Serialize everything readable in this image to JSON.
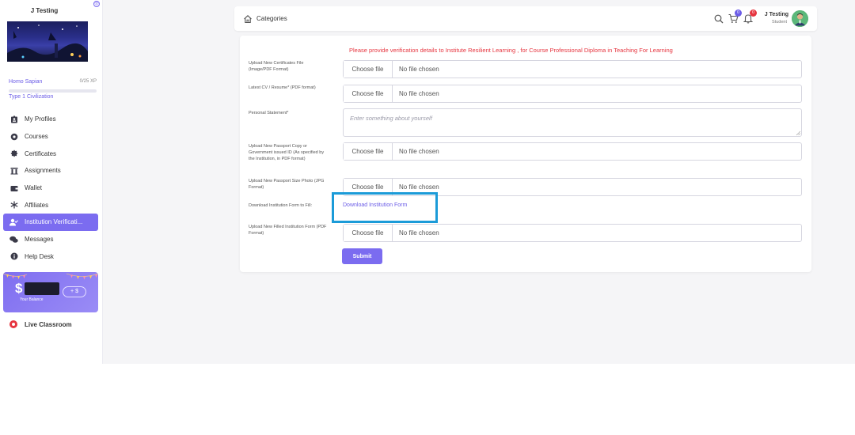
{
  "sidebar": {
    "user_name": "J Testing",
    "rank": "Homo Sapian",
    "xp": "0/25 XP",
    "xp_progress": 0,
    "civilization": "Type 1 Civilization",
    "items": [
      {
        "label": "My Profiles",
        "icon": "id-badge-icon"
      },
      {
        "label": "Courses",
        "icon": "courses-icon"
      },
      {
        "label": "Certificates",
        "icon": "certificate-icon"
      },
      {
        "label": "Assignments",
        "icon": "assignments-icon"
      },
      {
        "label": "Wallet",
        "icon": "wallet-icon"
      },
      {
        "label": "Affiliates",
        "icon": "affiliates-icon"
      },
      {
        "label": "Institution Verificati...",
        "icon": "user-check-icon",
        "active": true
      },
      {
        "label": "Messages",
        "icon": "messages-icon"
      },
      {
        "label": "Help Desk",
        "icon": "info-icon"
      }
    ],
    "balance": {
      "currency_symbol": "$",
      "label": "Your Balance",
      "add_button": "+ $"
    },
    "live_classroom": "Live Classroom"
  },
  "header": {
    "title": "Categories",
    "cart_count": "0",
    "notification_count": "0",
    "user_name": "J Testing",
    "user_role": "Student"
  },
  "form": {
    "notice": "Please provide verification details to Institute Resilient Learning , for Course Professional Diploma in Teaching For Learning",
    "certificates_label": "Upload New Certificates File (Image/PDF Format)",
    "cv_label": "Latest CV / Resume* (PDF format)",
    "statement_label": "Personal Statement*",
    "statement_placeholder": "Enter something about yourself",
    "passport_label": "Upload New Passport Copy or Government issued ID (As specified by the Institution, in PDF format)",
    "photo_label": "Upload New Passport Size Photo (JPG Format)",
    "download_label": "Download Institution Form to Fill:",
    "download_link": "Download Institution Form",
    "filled_label": "Upload New Filled Institution Form (PDF Format)",
    "choose_file": "Choose file",
    "no_file": "No file chosen",
    "submit": "Submit"
  },
  "colors": {
    "accent": "#7b6cf0",
    "notice": "#e6353f",
    "highlight": "#1b9bd8"
  }
}
